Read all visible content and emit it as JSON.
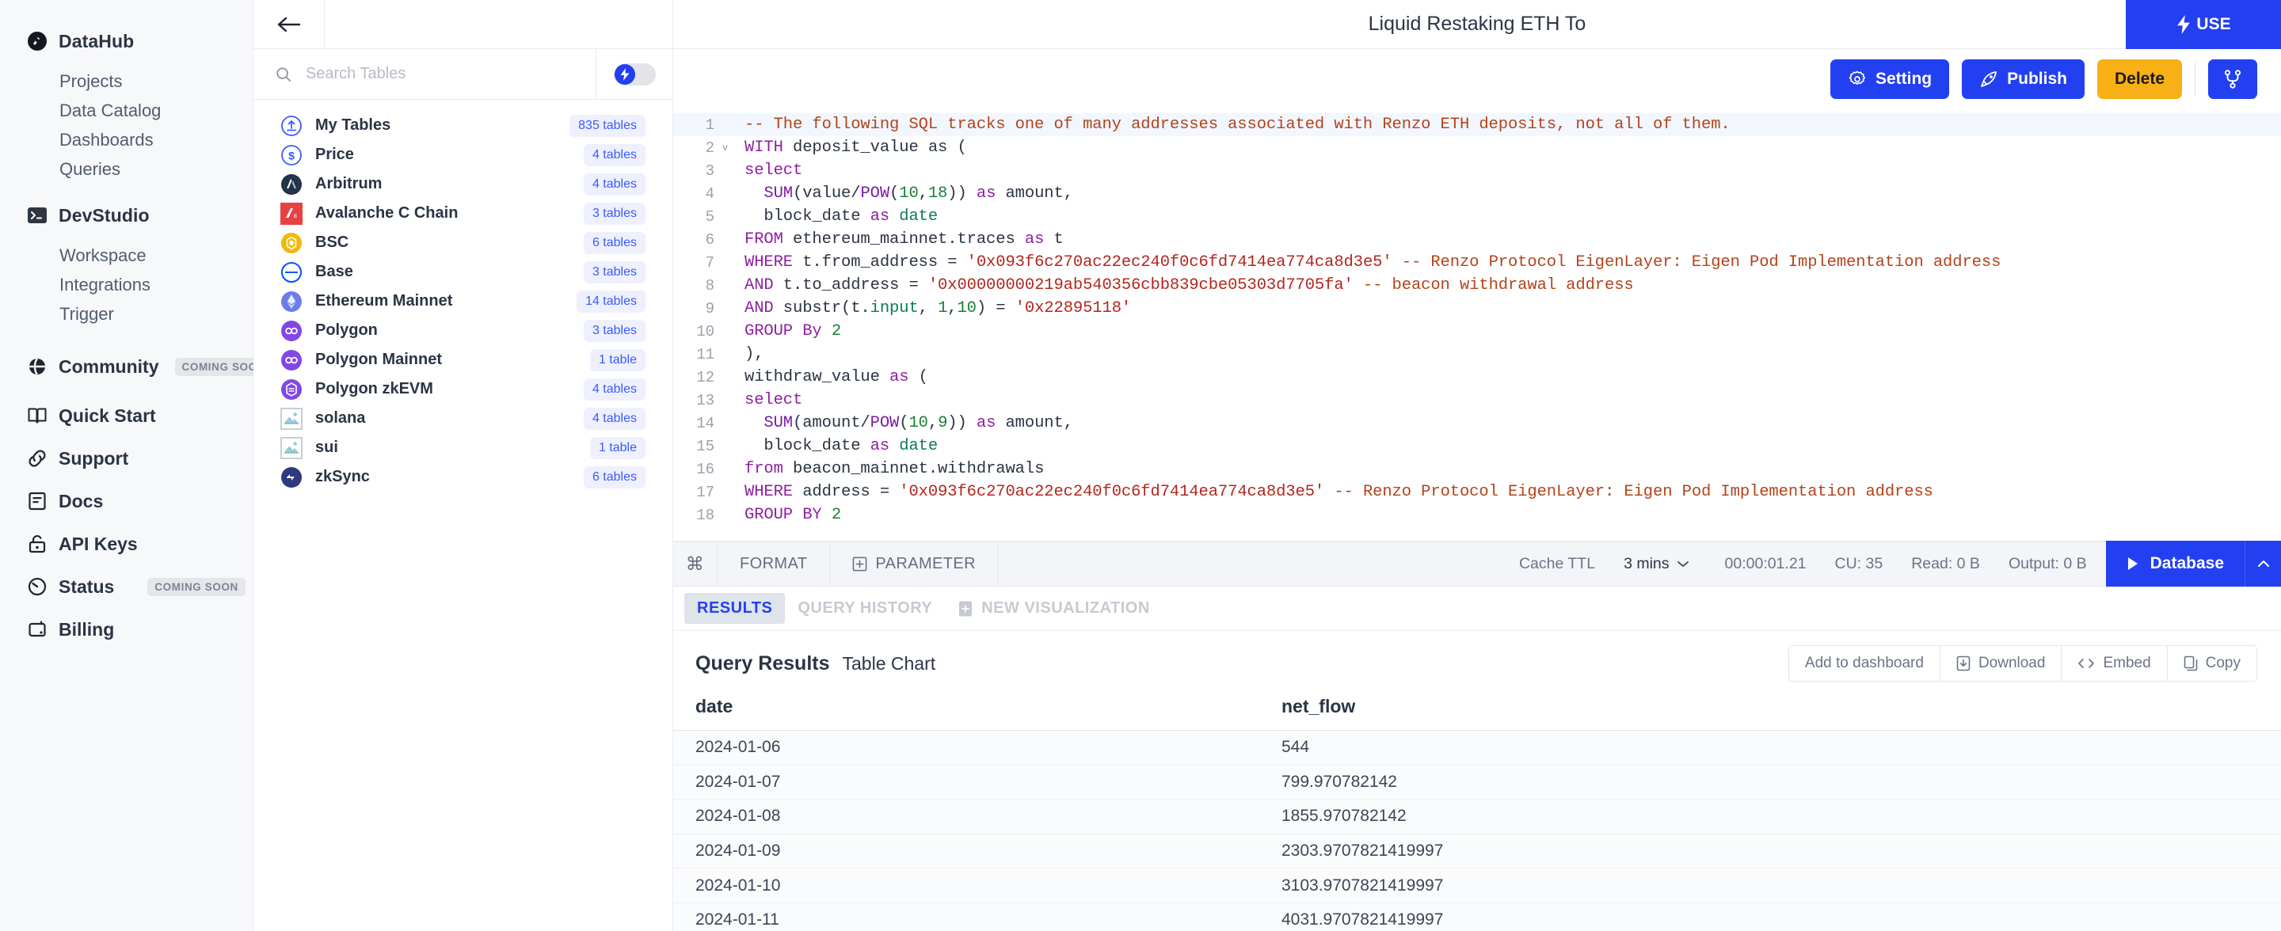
{
  "leftnav": {
    "groups": [
      {
        "icon": "datahub-icon",
        "label": "DataHub",
        "items": [
          {
            "label": "Projects",
            "name": "sidebar-item-projects"
          },
          {
            "label": "Data Catalog",
            "name": "sidebar-item-data-catalog"
          },
          {
            "label": "Dashboards",
            "name": "sidebar-item-dashboards"
          },
          {
            "label": "Queries",
            "name": "sidebar-item-queries"
          }
        ]
      },
      {
        "icon": "terminal-icon",
        "label": "DevStudio",
        "items": [
          {
            "label": "Workspace",
            "name": "sidebar-item-workspace"
          },
          {
            "label": "Integrations",
            "name": "sidebar-item-integrations"
          },
          {
            "label": "Trigger",
            "name": "sidebar-item-trigger"
          }
        ]
      }
    ],
    "links": [
      {
        "label": "Community",
        "icon": "globe-icon",
        "badge": "COMING SOON",
        "name": "sidebar-item-community"
      },
      {
        "label": "Quick Start",
        "icon": "book-icon",
        "badge": "",
        "name": "sidebar-item-quick-start"
      },
      {
        "label": "Support",
        "icon": "link-icon",
        "badge": "",
        "name": "sidebar-item-support"
      },
      {
        "label": "Docs",
        "icon": "document-icon",
        "badge": "",
        "name": "sidebar-item-docs"
      },
      {
        "label": "API Keys",
        "icon": "lock-icon",
        "badge": "",
        "name": "sidebar-item-api-keys"
      },
      {
        "label": "Status",
        "icon": "gauge-icon",
        "badge": "COMING SOON",
        "name": "sidebar-item-status"
      },
      {
        "label": "Billing",
        "icon": "wallet-icon",
        "badge": "",
        "name": "sidebar-item-billing"
      }
    ]
  },
  "tables_panel": {
    "back_icon": "back-arrow-icon",
    "search": {
      "placeholder": "Search Tables",
      "value": "",
      "icon": "search-icon"
    },
    "toggle": {
      "icon": "lightning-icon",
      "on": false
    },
    "items": [
      {
        "label": "My Tables",
        "count": "835 tables",
        "icon": "upload-circle-icon",
        "color": "#3b5bfd"
      },
      {
        "label": "Price",
        "count": "4 tables",
        "icon": "dollar-circle-icon",
        "color": "#3b5bfd"
      },
      {
        "label": "Arbitrum",
        "count": "4 tables",
        "icon": "arbitrum-icon",
        "color": "#213147"
      },
      {
        "label": "Avalanche C Chain",
        "count": "3 tables",
        "icon": "avalanche-icon",
        "color": "#e84142"
      },
      {
        "label": "BSC",
        "count": "6 tables",
        "icon": "bsc-icon",
        "color": "#f0b90b"
      },
      {
        "label": "Base",
        "count": "3 tables",
        "icon": "base-icon",
        "color": "#0052ff"
      },
      {
        "label": "Ethereum Mainnet",
        "count": "14 tables",
        "icon": "ethereum-icon",
        "color": "#6b7ee8"
      },
      {
        "label": "Polygon",
        "count": "3 tables",
        "icon": "polygon-icon",
        "color": "#8247e5"
      },
      {
        "label": "Polygon Mainnet",
        "count": "1 table",
        "icon": "polygon-icon",
        "color": "#8247e5"
      },
      {
        "label": "Polygon zkEVM",
        "count": "4 tables",
        "icon": "polygon-zkevm-icon",
        "color": "#8247e5"
      },
      {
        "label": "solana",
        "count": "4 tables",
        "icon": "broken-image-icon",
        "color": "#cccccc"
      },
      {
        "label": "sui",
        "count": "1 table",
        "icon": "broken-image-icon",
        "color": "#cccccc"
      },
      {
        "label": "zkSync",
        "count": "6 tables",
        "icon": "zksync-icon",
        "color": "#2e3a7d"
      }
    ]
  },
  "header": {
    "title": "Liquid Restaking ETH To",
    "use_label": "USE",
    "use_icon": "lightning-icon"
  },
  "actions": {
    "setting": {
      "label": "Setting",
      "icon": "gear-icon"
    },
    "publish": {
      "label": "Publish",
      "icon": "rocket-icon"
    },
    "delete": {
      "label": "Delete"
    },
    "fork": {
      "icon": "fork-icon"
    }
  },
  "editor": {
    "lines": [
      {
        "n": "1",
        "fold": "",
        "highlight": true
      },
      {
        "n": "2",
        "fold": "v",
        "highlight": false
      },
      {
        "n": "3",
        "fold": "",
        "highlight": false
      },
      {
        "n": "4",
        "fold": "",
        "highlight": false
      },
      {
        "n": "5",
        "fold": "",
        "highlight": false
      },
      {
        "n": "6",
        "fold": "",
        "highlight": false
      },
      {
        "n": "7",
        "fold": "",
        "highlight": false
      },
      {
        "n": "8",
        "fold": "",
        "highlight": false
      },
      {
        "n": "9",
        "fold": "",
        "highlight": false
      },
      {
        "n": "10",
        "fold": "",
        "highlight": false
      },
      {
        "n": "11",
        "fold": "",
        "highlight": false
      },
      {
        "n": "12",
        "fold": "",
        "highlight": false
      },
      {
        "n": "13",
        "fold": "",
        "highlight": false
      },
      {
        "n": "14",
        "fold": "",
        "highlight": false
      },
      {
        "n": "15",
        "fold": "",
        "highlight": false
      },
      {
        "n": "16",
        "fold": "",
        "highlight": false
      },
      {
        "n": "17",
        "fold": "",
        "highlight": false
      },
      {
        "n": "18",
        "fold": "",
        "highlight": false
      }
    ],
    "code": {
      "l1": "-- The following SQL tracks one of many addresses associated with Renzo ETH deposits, not all of them.",
      "l2_k": "WITH",
      "l2_rest": " deposit_value as (",
      "l3": "select",
      "l4_fn": "SUM",
      "l4_a": "(value/",
      "l4_fn2": "POW",
      "l4_b": "(",
      "l4_n1": "10",
      "l4_c": ",",
      "l4_n2": "18",
      "l4_d": ")) ",
      "l4_as": "as",
      "l4_e": " amount,",
      "l5_a": "  block_date ",
      "l5_as": "as",
      "l5_b": " ",
      "l5_date": "date",
      "l6_k": "FROM",
      "l6_rest": " ethereum_mainnet.traces ",
      "l6_as": "as",
      "l6_t": " t",
      "l7_k": "WHERE",
      "l7_a": " t.from_address = ",
      "l7_s": "'0x093f6c270ac22ec240f0c6fd7414ea774ca8d3e5'",
      "l7_c": " -- Renzo Protocol EigenLayer: Eigen Pod Implementation address",
      "l8_k": "AND",
      "l8_a": " t.to_address = ",
      "l8_s": "'0x00000000219ab540356cbb839cbe05303d7705fa'",
      "l8_c": " -- beacon withdrawal address",
      "l9_k": "AND",
      "l9_a": " substr(t.",
      "l9_in": "input",
      "l9_b": ", ",
      "l9_n1": "1",
      "l9_c2": ",",
      "l9_n2": "10",
      "l9_d": ") = ",
      "l9_s": "'0x22895118'",
      "l10_k": "GROUP By",
      "l10_n": " 2",
      "l11": "),",
      "l12_a": "withdraw_value ",
      "l12_as": "as",
      "l12_b": " (",
      "l13": "select",
      "l14_fn": "SUM",
      "l14_a": "(amount/",
      "l14_fn2": "POW",
      "l14_b": "(",
      "l14_n1": "10",
      "l14_c": ",",
      "l14_n2": "9",
      "l14_d": ")) ",
      "l14_as": "as",
      "l14_e": " amount,",
      "l15_a": "  block_date ",
      "l15_as": "as",
      "l15_b": " ",
      "l15_date": "date",
      "l16_k": "from",
      "l16_rest": " beacon_mainnet.withdrawals",
      "l17_k": "WHERE",
      "l17_a": " address = ",
      "l17_s": "'0x093f6c270ac22ec240f0c6fd7414ea774ca8d3e5'",
      "l17_c": " -- Renzo Protocol EigenLayer: Eigen Pod Implementation address",
      "l18_k": "GROUP BY",
      "l18_n": " 2"
    }
  },
  "toolbar": {
    "cmd_icon": "command-icon",
    "format_label": "FORMAT",
    "parameter_label": "PARAMETER",
    "parameter_icon": "plus-box-icon",
    "cache_ttl_label": "Cache TTL",
    "cache_ttl_value": "3 mins",
    "cache_caret_icon": "chevron-down-icon",
    "duration": "00:00:01.21",
    "cu": "CU: 35",
    "read": "Read: 0 B",
    "output": "Output: 0 B",
    "run_label": "Database",
    "run_icon": "play-icon",
    "collapse_icon": "chevron-up-icon"
  },
  "result_tabs": [
    {
      "label": "RESULTS",
      "active": true,
      "icon": ""
    },
    {
      "label": "QUERY HISTORY",
      "active": false,
      "icon": ""
    },
    {
      "label": "NEW VISUALIZATION",
      "active": false,
      "icon": "chart-add-icon"
    }
  ],
  "results": {
    "title": "Query Results",
    "subtitle": "Table Chart",
    "buttons": [
      {
        "label": "Add to dashboard",
        "icon": "",
        "name": "add-to-dashboard-button"
      },
      {
        "label": "Download",
        "icon": "download-icon",
        "name": "download-button"
      },
      {
        "label": "Embed",
        "icon": "code-icon",
        "name": "embed-button"
      },
      {
        "label": "Copy",
        "icon": "copy-icon",
        "name": "copy-button"
      }
    ],
    "columns": [
      "date",
      "net_flow"
    ],
    "rows": [
      [
        "2024-01-06",
        "544"
      ],
      [
        "2024-01-07",
        "799.970782142"
      ],
      [
        "2024-01-08",
        "1855.970782142"
      ],
      [
        "2024-01-09",
        "2303.9707821419997"
      ],
      [
        "2024-01-10",
        "3103.9707821419997"
      ],
      [
        "2024-01-11",
        "4031.9707821419997"
      ]
    ]
  },
  "colors": {
    "primary": "#2340f0",
    "amber": "#f7b015",
    "text": "#2b3445",
    "muted": "#6a7485"
  }
}
